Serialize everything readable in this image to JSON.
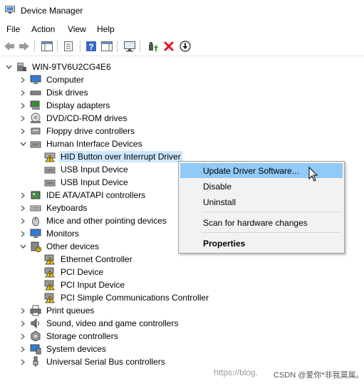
{
  "window": {
    "title": "Device Manager"
  },
  "menu": [
    "File",
    "Action",
    "View",
    "Help"
  ],
  "tree": {
    "root": "WIN-9TV6U2CG4E6",
    "categories": [
      "Computer",
      "Disk drives",
      "Display adapters",
      "DVD/CD-ROM drives",
      "Floppy drive controllers",
      "Human Interface Devices",
      "IDE ATA/ATAPI controllers",
      "Keyboards",
      "Mice and other pointing devices",
      "Monitors",
      "Other devices",
      "Print queues",
      "Sound, video and game controllers",
      "Storage controllers",
      "System devices",
      "Universal Serial Bus controllers"
    ],
    "hid_children": [
      "HID Button over Interrupt Driver",
      "USB Input Device",
      "USB Input Device"
    ],
    "other_children": [
      "Ethernet Controller",
      "PCI Device",
      "PCI Input Device",
      "PCI Simple Communications Controller"
    ]
  },
  "context_menu": {
    "update": "Update Driver Software...",
    "disable": "Disable",
    "uninstall": "Uninstall",
    "scan": "Scan for hardware changes",
    "properties": "Properties"
  },
  "watermark": {
    "url": "https://blog.",
    "author": "CSDN @爱你*非我莫属。"
  },
  "colors": {
    "selection": "#cce8ff",
    "menu_highlight": "#91c9f7",
    "error_red": "#e81123",
    "warning_yellow": "#f5c400"
  }
}
